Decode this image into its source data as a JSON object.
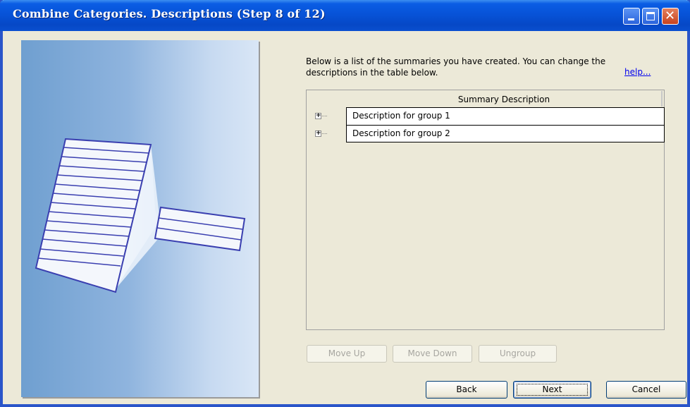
{
  "window": {
    "title": "Combine Categories.  Descriptions (Step 8 of 12)",
    "titlebar_color": "#0753d8",
    "controls": [
      "minimize-icon",
      "maximize-icon",
      "close-icon"
    ]
  },
  "main": {
    "intro_text": "Below is a list of the summaries you have created. You can change the descriptions in the table below.",
    "help_label": "help...",
    "grid": {
      "column_header": "Summary Description",
      "rows": [
        {
          "expander": "+",
          "description": "Description for group 1"
        },
        {
          "expander": "+",
          "description": "Description for group 2"
        }
      ]
    },
    "row_buttons": {
      "move_up": "Move Up",
      "move_down": "Move Down",
      "ungroup": "Ungroup"
    }
  },
  "footer": {
    "back": "Back",
    "next": "Next",
    "cancel": "Cancel"
  }
}
